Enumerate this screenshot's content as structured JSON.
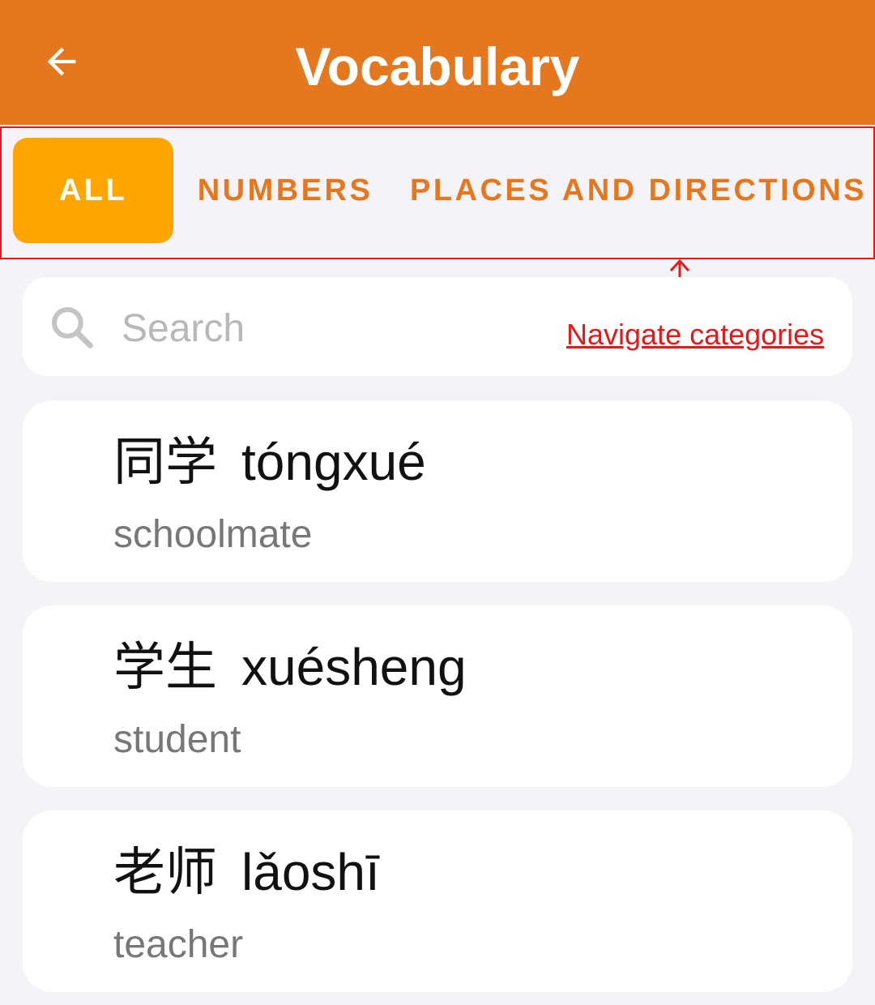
{
  "header": {
    "title": "Vocabulary",
    "back_icon": "arrow-left-icon",
    "background_color": "#e5771e"
  },
  "tabs": [
    {
      "label": "ALL",
      "active": true
    },
    {
      "label": "NUMBERS",
      "active": false
    },
    {
      "label": "PLACES AND DIRECTIONS",
      "active": false
    }
  ],
  "annotation": {
    "text": "Navigate categories",
    "color": "#e81818"
  },
  "search": {
    "placeholder": "Search",
    "value": "",
    "icon": "search-icon"
  },
  "words": [
    {
      "hanzi": "同学",
      "pinyin": "tóngxué",
      "meaning": "schoolmate"
    },
    {
      "hanzi": "学生",
      "pinyin": "xuésheng",
      "meaning": "student"
    },
    {
      "hanzi": "老师",
      "pinyin": "lǎoshī",
      "meaning": "teacher"
    }
  ],
  "colors": {
    "accent": "#e5771e",
    "active_tab": "#fea500",
    "background": "#f4f3f8"
  }
}
